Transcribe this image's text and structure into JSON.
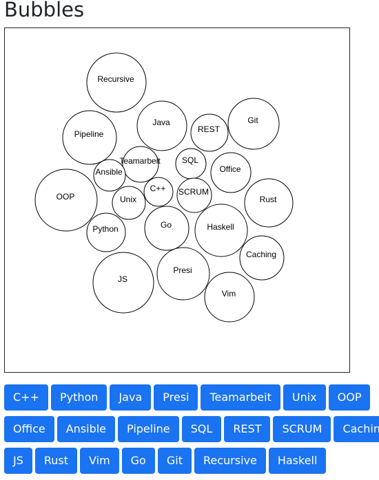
{
  "page": {
    "title": "Bubbles"
  },
  "bubbles": [
    {
      "label": "Recursive"
    },
    {
      "label": "Pipeline"
    },
    {
      "label": "Java"
    },
    {
      "label": "REST"
    },
    {
      "label": "Git"
    },
    {
      "label": "Teamarbeit"
    },
    {
      "label": "SQL"
    },
    {
      "label": "Ansible"
    },
    {
      "label": "Office"
    },
    {
      "label": "C++"
    },
    {
      "label": "SCRUM"
    },
    {
      "label": "OOP"
    },
    {
      "label": "Unix"
    },
    {
      "label": "Rust"
    },
    {
      "label": "Go"
    },
    {
      "label": "Haskell"
    },
    {
      "label": "Python"
    },
    {
      "label": "Caching"
    },
    {
      "label": "JS"
    },
    {
      "label": "Presi"
    },
    {
      "label": "Vim"
    }
  ],
  "button_rows": [
    [
      "C++",
      "Python",
      "Java",
      "Presi",
      "Teamarbeit",
      "Unix",
      "OOP"
    ],
    [
      "Office",
      "Ansible",
      "Pipeline",
      "SQL",
      "REST",
      "SCRUM",
      "Caching"
    ],
    [
      "JS",
      "Rust",
      "Vim",
      "Go",
      "Git",
      "Recursive",
      "Haskell"
    ]
  ]
}
